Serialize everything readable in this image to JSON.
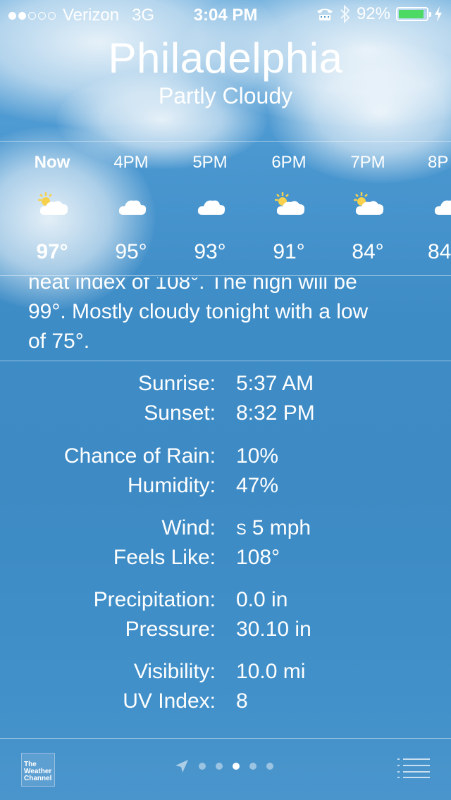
{
  "status_bar": {
    "carrier": "Verizon",
    "network": "3G",
    "time": "3:04 PM",
    "battery": "92%",
    "battery_level": 0.92,
    "signal_bars_filled": 2,
    "signal_bars_total": 5
  },
  "location": {
    "city": "Philadelphia",
    "condition": "Partly Cloudy"
  },
  "hourly": [
    {
      "time": "Now",
      "icon": "partly-sunny-icon",
      "temp": "97°"
    },
    {
      "time": "4PM",
      "icon": "cloud-icon",
      "temp": "95°"
    },
    {
      "time": "5PM",
      "icon": "cloud-icon",
      "temp": "93°"
    },
    {
      "time": "6PM",
      "icon": "partly-sunny-icon",
      "temp": "91°"
    },
    {
      "time": "7PM",
      "icon": "partly-sunny-icon",
      "temp": "84°"
    },
    {
      "time": "8P",
      "icon": "cloud-icon",
      "temp": "84"
    }
  ],
  "summary": {
    "line1": "heat index of 108°. The high will be",
    "line2": "99°. Mostly cloudy tonight with a low",
    "line3": "of 75°."
  },
  "details": [
    {
      "label": "Sunrise:",
      "value": "5:37 AM"
    },
    {
      "label": "Sunset:",
      "value": "8:32 PM"
    },
    {
      "label": "Chance of Rain:",
      "value": "10%"
    },
    {
      "label": "Humidity:",
      "value": "47%"
    },
    {
      "label": "Wind:",
      "dir": "S",
      "value": "5 mph"
    },
    {
      "label": "Feels Like:",
      "value": "108°"
    },
    {
      "label": "Precipitation:",
      "value": "0.0 in"
    },
    {
      "label": "Pressure:",
      "value": "30.10 in"
    },
    {
      "label": "Visibility:",
      "value": "10.0 mi"
    },
    {
      "label": "UV Index:",
      "value": "8"
    }
  ],
  "footer": {
    "logo_line1": "The",
    "logo_line2": "Weather",
    "logo_line3": "Channel",
    "page_count": 5,
    "active_page": 3
  },
  "colors": {
    "battery_fill": "#4cd964",
    "sky": "#3f8fc7"
  }
}
